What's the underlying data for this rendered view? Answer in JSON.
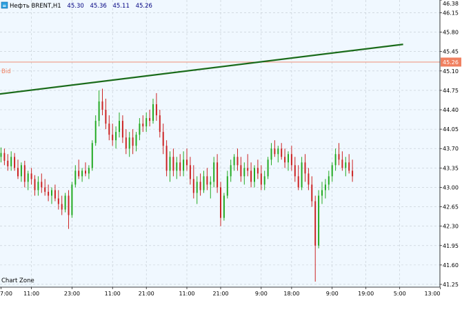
{
  "header": {
    "symbol": "Нефть BRENT,H1",
    "open": "45.30",
    "high": "45.36",
    "low": "45.11",
    "close": "45.26"
  },
  "watermark": "Chart Zone",
  "bid": {
    "label": "Bid",
    "value": 45.26,
    "value_label": "45.26",
    "color": "#f08060"
  },
  "colors": {
    "background": "#f0f8ff",
    "grid": "#c0c8d0",
    "candle_up": "#22aa22",
    "candle_down": "#cc2222",
    "trendline": "#1a6b1a",
    "axis_text": "#000000",
    "header_text": "#000080"
  },
  "chart_data": {
    "type": "candlestick",
    "timeframe": "H1",
    "ylim": [
      41.2,
      46.38
    ],
    "y_ticks": [
      "46.38",
      "46.15",
      "45.80",
      "45.45",
      "45.10",
      "44.75",
      "44.40",
      "44.05",
      "43.70",
      "43.35",
      "43.00",
      "42.65",
      "42.30",
      "41.95",
      "41.60",
      "41.25"
    ],
    "x_ticks": [
      {
        "label": "7:00",
        "bar": 0
      },
      {
        "label": "11:00",
        "bar": 9
      },
      {
        "label": "23:00",
        "bar": 21
      },
      {
        "label": "11:00",
        "bar": 33
      },
      {
        "label": "21:00",
        "bar": 43
      },
      {
        "label": "11:00",
        "bar": 55
      },
      {
        "label": "21:00",
        "bar": 65
      },
      {
        "label": "9:00",
        "bar": 77
      },
      {
        "label": "18:00",
        "bar": 86
      },
      {
        "label": "9:00",
        "bar": 98
      },
      {
        "label": "19:00",
        "bar": 108
      },
      {
        "label": "5:00",
        "bar": 118
      },
      {
        "label": "13:00",
        "bar": 130
      }
    ],
    "trendline": {
      "from": {
        "bar": -1,
        "price": 44.68
      },
      "to": {
        "bar": 119,
        "price": 45.58
      }
    },
    "candles": [
      [
        43.55,
        43.72,
        43.45,
        43.62
      ],
      [
        43.62,
        43.7,
        43.4,
        43.48
      ],
      [
        43.48,
        43.6,
        43.3,
        43.38
      ],
      [
        43.38,
        43.65,
        43.3,
        43.55
      ],
      [
        43.55,
        43.62,
        43.3,
        43.35
      ],
      [
        43.35,
        43.5,
        43.15,
        43.2
      ],
      [
        43.2,
        43.45,
        43.1,
        43.4
      ],
      [
        43.4,
        43.48,
        43.0,
        43.1
      ],
      [
        43.1,
        43.3,
        42.95,
        43.25
      ],
      [
        43.25,
        43.35,
        43.05,
        43.15
      ],
      [
        43.15,
        43.22,
        42.85,
        42.95
      ],
      [
        42.95,
        43.2,
        42.85,
        43.1
      ],
      [
        43.1,
        43.25,
        42.9,
        43.0
      ],
      [
        43.0,
        43.15,
        42.85,
        42.92
      ],
      [
        42.92,
        43.05,
        42.75,
        42.85
      ],
      [
        42.85,
        43.0,
        42.7,
        42.95
      ],
      [
        42.95,
        43.05,
        42.75,
        42.8
      ],
      [
        42.8,
        42.95,
        42.6,
        42.7
      ],
      [
        42.7,
        42.85,
        42.5,
        42.6
      ],
      [
        42.6,
        42.9,
        42.55,
        42.85
      ],
      [
        42.85,
        42.95,
        42.25,
        42.5
      ],
      [
        42.5,
        43.1,
        42.45,
        43.05
      ],
      [
        43.05,
        43.4,
        43.0,
        43.3
      ],
      [
        43.3,
        43.5,
        43.15,
        43.2
      ],
      [
        43.2,
        43.35,
        43.1,
        43.3
      ],
      [
        43.3,
        43.45,
        43.2,
        43.25
      ],
      [
        43.25,
        43.4,
        43.15,
        43.35
      ],
      [
        43.35,
        43.85,
        43.3,
        43.8
      ],
      [
        43.8,
        44.3,
        43.75,
        44.2
      ],
      [
        44.2,
        44.75,
        44.1,
        44.55
      ],
      [
        44.55,
        44.78,
        44.3,
        44.4
      ],
      [
        44.4,
        44.6,
        44.05,
        44.15
      ],
      [
        44.15,
        44.3,
        43.85,
        43.95
      ],
      [
        43.95,
        44.15,
        43.75,
        43.85
      ],
      [
        43.85,
        44.1,
        43.7,
        44.0
      ],
      [
        44.0,
        44.35,
        43.9,
        44.2
      ],
      [
        44.2,
        44.3,
        43.8,
        43.9
      ],
      [
        43.9,
        44.05,
        43.6,
        43.7
      ],
      [
        43.7,
        44.0,
        43.55,
        43.9
      ],
      [
        43.9,
        44.05,
        43.6,
        43.75
      ],
      [
        43.75,
        44.0,
        43.65,
        43.95
      ],
      [
        43.95,
        44.25,
        43.85,
        44.15
      ],
      [
        44.15,
        44.3,
        44.0,
        44.1
      ],
      [
        44.1,
        44.35,
        44.0,
        44.25
      ],
      [
        44.25,
        44.4,
        44.1,
        44.2
      ],
      [
        44.2,
        44.6,
        44.15,
        44.5
      ],
      [
        44.5,
        44.7,
        44.2,
        44.3
      ],
      [
        44.3,
        44.4,
        43.9,
        44.0
      ],
      [
        44.0,
        44.15,
        43.6,
        43.75
      ],
      [
        43.75,
        43.85,
        43.2,
        43.3
      ],
      [
        43.3,
        43.65,
        43.1,
        43.55
      ],
      [
        43.55,
        43.7,
        43.2,
        43.3
      ],
      [
        43.3,
        43.55,
        43.15,
        43.45
      ],
      [
        43.45,
        43.6,
        43.2,
        43.3
      ],
      [
        43.3,
        43.65,
        43.2,
        43.5
      ],
      [
        43.5,
        43.7,
        43.3,
        43.4
      ],
      [
        43.4,
        43.55,
        43.05,
        43.15
      ],
      [
        43.15,
        43.4,
        42.8,
        42.9
      ],
      [
        42.9,
        43.2,
        42.7,
        43.1
      ],
      [
        43.1,
        43.25,
        42.85,
        42.95
      ],
      [
        42.95,
        43.3,
        42.9,
        43.2
      ],
      [
        43.2,
        43.35,
        42.95,
        43.05
      ],
      [
        43.05,
        43.2,
        42.8,
        43.1
      ],
      [
        43.1,
        43.55,
        43.0,
        43.45
      ],
      [
        43.45,
        43.6,
        42.9,
        43.0
      ],
      [
        43.0,
        43.1,
        42.3,
        42.45
      ],
      [
        42.45,
        42.9,
        42.4,
        42.85
      ],
      [
        42.85,
        43.3,
        42.8,
        43.2
      ],
      [
        43.2,
        43.5,
        43.1,
        43.4
      ],
      [
        43.4,
        43.6,
        43.3,
        43.55
      ],
      [
        43.55,
        43.7,
        43.3,
        43.4
      ],
      [
        43.4,
        43.55,
        43.1,
        43.2
      ],
      [
        43.2,
        43.45,
        43.05,
        43.35
      ],
      [
        43.35,
        43.6,
        43.2,
        43.3
      ],
      [
        43.3,
        43.45,
        43.0,
        43.1
      ],
      [
        43.1,
        43.4,
        43.0,
        43.35
      ],
      [
        43.35,
        43.5,
        43.15,
        43.25
      ],
      [
        43.25,
        43.4,
        42.95,
        43.05
      ],
      [
        43.05,
        43.3,
        42.95,
        43.2
      ],
      [
        43.2,
        43.55,
        43.15,
        43.5
      ],
      [
        43.5,
        43.8,
        43.4,
        43.7
      ],
      [
        43.7,
        43.85,
        43.55,
        43.6
      ],
      [
        43.6,
        43.75,
        43.45,
        43.7
      ],
      [
        43.7,
        43.8,
        43.5,
        43.55
      ],
      [
        43.55,
        43.7,
        43.35,
        43.45
      ],
      [
        43.45,
        43.65,
        43.3,
        43.6
      ],
      [
        43.6,
        43.75,
        43.3,
        43.4
      ],
      [
        43.4,
        43.55,
        43.1,
        43.2
      ],
      [
        43.2,
        43.4,
        42.95,
        43.0
      ],
      [
        43.0,
        43.55,
        42.95,
        43.45
      ],
      [
        43.45,
        43.6,
        43.1,
        43.25
      ],
      [
        43.25,
        43.35,
        42.95,
        43.05
      ],
      [
        43.05,
        43.2,
        42.65,
        42.75
      ],
      [
        42.75,
        42.85,
        41.3,
        41.95
      ],
      [
        41.95,
        42.95,
        41.9,
        42.85
      ],
      [
        42.85,
        43.1,
        42.7,
        42.95
      ],
      [
        42.95,
        43.15,
        42.8,
        43.05
      ],
      [
        43.05,
        43.3,
        42.95,
        43.2
      ],
      [
        43.2,
        43.45,
        43.1,
        43.4
      ],
      [
        43.4,
        43.7,
        43.3,
        43.6
      ],
      [
        43.6,
        43.8,
        43.4,
        43.5
      ],
      [
        43.5,
        43.65,
        43.3,
        43.35
      ],
      [
        43.35,
        43.55,
        43.2,
        43.45
      ],
      [
        43.45,
        43.6,
        43.25,
        43.3
      ],
      [
        43.3,
        43.5,
        43.1,
        43.2
      ]
    ]
  }
}
